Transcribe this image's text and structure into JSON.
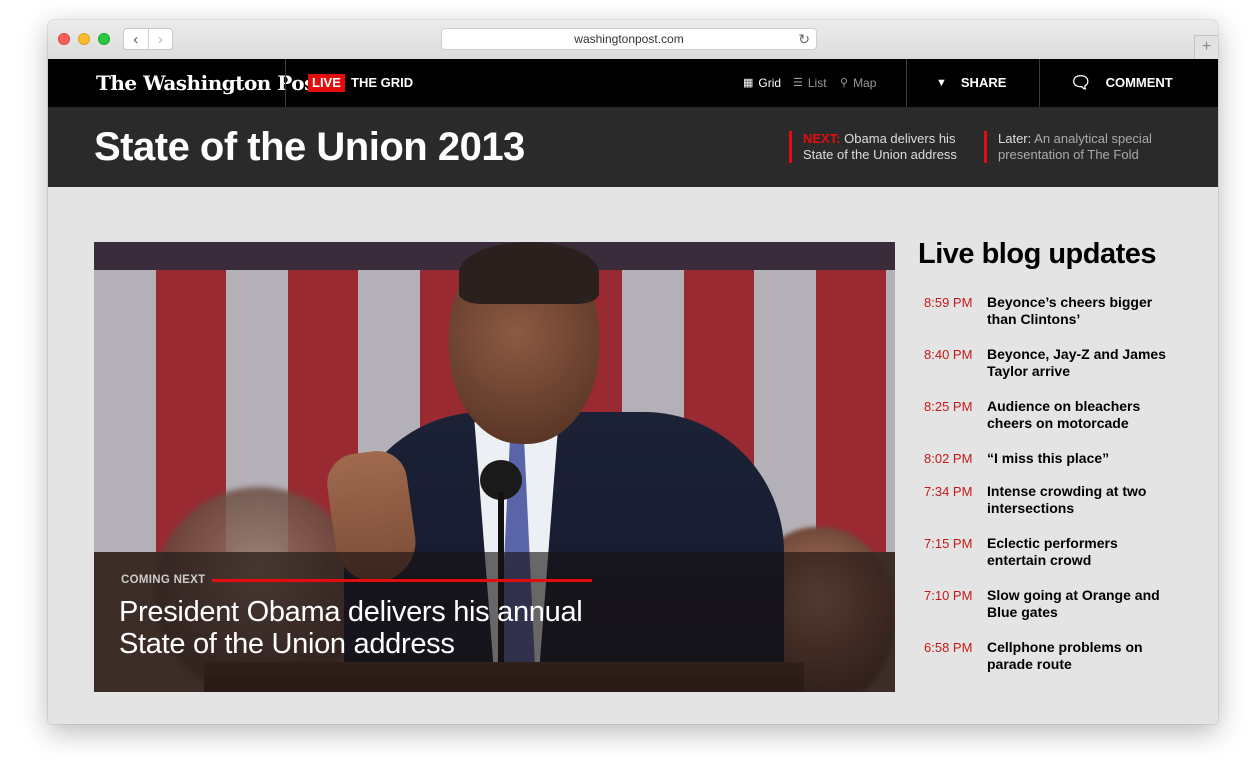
{
  "browser": {
    "url": "washingtonpost.com",
    "back_icon": "chevron-left-icon",
    "forward_icon": "chevron-right-icon",
    "reload_icon": "reload-icon",
    "newtab_icon": "plus-icon"
  },
  "site": {
    "logo": "The Washington Post",
    "live_badge": "LIVE",
    "section_title": "THE GRID",
    "views": [
      {
        "label": "Grid",
        "icon": "grid-icon",
        "active": true
      },
      {
        "label": "List",
        "icon": "list-icon",
        "active": false
      },
      {
        "label": "Map",
        "icon": "map-pin-icon",
        "active": false
      }
    ],
    "share_label": "SHARE",
    "comment_label": "COMMENT"
  },
  "banner": {
    "title": "State of the Union 2013",
    "next_label": "NEXT:",
    "next_text_1": " Obama delivers his",
    "next_text_2": "State of the Union address",
    "later_label": "Later:",
    "later_text_1": " An analytical special",
    "later_text_2": "presentation of The Fold"
  },
  "hero": {
    "coming_next": "COMING NEXT",
    "headline_1": "President Obama delivers his annual",
    "headline_2": "State of the Union address"
  },
  "blog": {
    "title": "Live blog updates",
    "items": [
      {
        "time": "8:59 PM",
        "text": "Beyonce’s cheers bigger than Clintons’"
      },
      {
        "time": "8:40 PM",
        "text": "Beyonce, Jay-Z and James Taylor arrive"
      },
      {
        "time": "8:25 PM",
        "text": "Audience on bleachers cheers on motorcade"
      },
      {
        "time": "8:02 PM",
        "text": "“I miss this place”"
      },
      {
        "time": "7:34 PM",
        "text": "Intense crowding at two intersections"
      },
      {
        "time": "7:15 PM",
        "text": "Eclectic performers entertain crowd"
      },
      {
        "time": "7:10 PM",
        "text": "Slow going at Orange and Blue gates"
      },
      {
        "time": "6:58 PM",
        "text": "Cellphone problems on parade route"
      }
    ]
  },
  "colors": {
    "accent_red": "#e40d0d",
    "time_red": "#c21a1a",
    "header_black": "#000000",
    "band_dark": "#2a2a2a",
    "page_bg": "#e4e4e4"
  }
}
